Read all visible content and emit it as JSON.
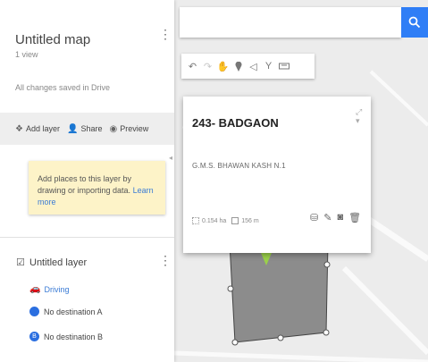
{
  "map_panel": {
    "title": "Untitled map",
    "views": "1 view",
    "saved_status": "All changes saved in Drive",
    "actions": [
      {
        "icon": "add-layer-icon",
        "label": "Add layer"
      },
      {
        "icon": "share-icon",
        "label": "Share"
      },
      {
        "icon": "preview-icon",
        "label": "Preview"
      }
    ],
    "hint": {
      "text": "Add places to this layer by drawing or importing data.",
      "link": "Learn more"
    },
    "layer": {
      "title": "Untitled layer",
      "mode": "Driving",
      "destinations": [
        {
          "badge": "A",
          "label": "No destination A"
        },
        {
          "badge": "B",
          "label": "No destination B"
        }
      ]
    }
  },
  "toolbar": {
    "tools": [
      "undo-icon",
      "redo-icon",
      "hand-icon",
      "marker-icon",
      "draw-line-icon",
      "directions-icon",
      "ruler-icon"
    ]
  },
  "feature_card": {
    "title": "243- BADGAON",
    "description": "G.M.S. BHAWAN KASH N.1",
    "area": "0.154 ha",
    "perimeter": "156 m",
    "tools": [
      "style-icon",
      "edit-icon",
      "camera-icon",
      "delete-icon"
    ]
  },
  "colors": {
    "accent": "#2f7ef6",
    "hint_bg": "#fdf3c8",
    "polygon_fill": "#8c8c8c",
    "marker": "#9bd14a"
  }
}
